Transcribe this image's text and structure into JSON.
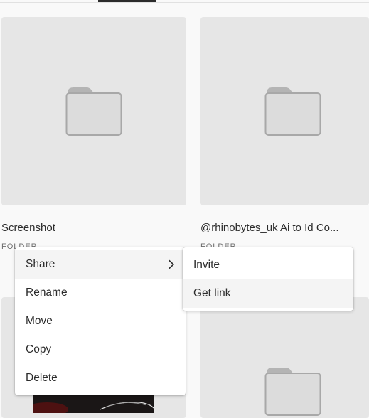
{
  "cards": [
    {
      "title": "Screenshot",
      "subtitle": "FOLDER"
    },
    {
      "title": "@rhinobytes_uk Ai to Id Co...",
      "subtitle": "FOLDER"
    }
  ],
  "context_menu": {
    "items": [
      "Share",
      "Rename",
      "Move",
      "Copy",
      "Delete"
    ]
  },
  "share_submenu": {
    "items": [
      "Invite",
      "Get link"
    ]
  },
  "colors": {
    "card_bg": "#e6e6e6",
    "folder_fill": "#dcdcdc",
    "folder_stroke": "#a8a8a8",
    "menu_hover": "#f4f4f4"
  },
  "icons": {
    "folder": "folder-icon",
    "submenu": "chevron-right-icon"
  }
}
